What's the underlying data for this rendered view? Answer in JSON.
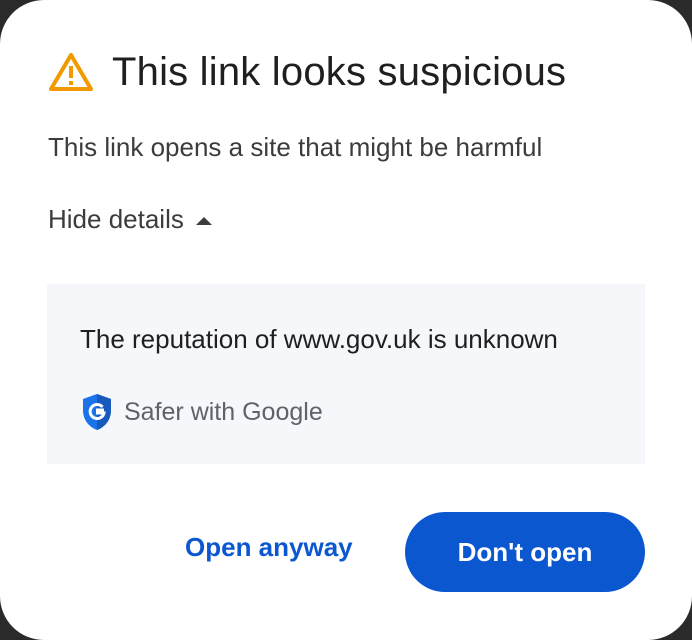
{
  "dialog": {
    "title": "This link looks suspicious",
    "warning_icon": "warning-triangle-icon",
    "subtitle": "This link opens a site that might be harmful",
    "details_toggle": {
      "label": "Hide details",
      "icon": "caret-up-icon"
    },
    "details": {
      "reputation_text": "The reputation of www.gov.uk is unknown",
      "safer_icon": "google-shield-icon",
      "safer_label": "Safer with Google"
    },
    "actions": {
      "open_anyway_label": "Open anyway",
      "dont_open_label": "Don't open"
    }
  },
  "colors": {
    "accent": "#0b57d0",
    "warning": "#f29900",
    "details_background": "#f5f7fa",
    "title_text": "#1f1f1f"
  }
}
